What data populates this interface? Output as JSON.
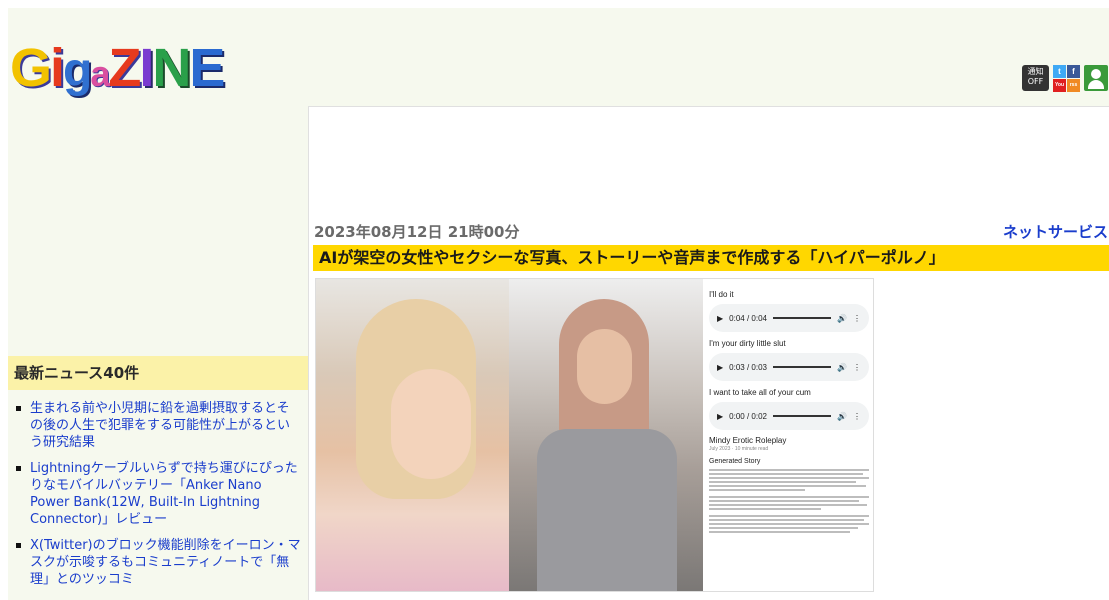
{
  "logo": {
    "g1": "G",
    "i": "i",
    "g2": "g",
    "a": "a",
    "z": "Z",
    "i2": "I",
    "n": "N",
    "e": "E"
  },
  "header_icons": {
    "notify_line1": "通知",
    "notify_line2": "OFF",
    "twitter": "t",
    "facebook": "f",
    "youtube": "You",
    "rss": "rss",
    "icons": [
      "notify-toggle-icon",
      "twitter-icon",
      "facebook-icon",
      "youtube-icon",
      "rss-icon",
      "user-icon"
    ]
  },
  "sidebar": {
    "heading": "最新ニュース40件",
    "items": [
      "生まれる前や小児期に鉛を過剰摂取するとその後の人生で犯罪をする可能性が上がるという研究結果",
      "Lightningケーブルいらずで持ち運びにぴったりなモバイルバッテリー「Anker Nano Power Bank(12W, Built-In Lightning Connector)」レビュー",
      "X(Twitter)のブロック機能削除をイーロン・マスクが示唆するもコミュニティノートで「無理」とのツッコミ"
    ]
  },
  "article": {
    "date": "2023年08月12日 21時00分",
    "category": "ネットサービス",
    "title": "AIが架空の女性やセクシーな写真、ストーリーや音声まで作成する「ハイパーポルノ」"
  },
  "image_panel": {
    "audio": [
      {
        "label": "I'll do it",
        "time": "0:04 / 0:04"
      },
      {
        "label": "I'm your dirty little slut",
        "time": "0:03 / 0:03"
      },
      {
        "label": "I want to take all of your cum",
        "time": "0:00 / 0:02"
      }
    ],
    "story_title": "Mindy Erotic Roleplay",
    "story_date": "July 2023 · 10 minute read",
    "story_heading": "Generated Story"
  },
  "colors": {
    "page_bg": "#f6f9ee",
    "title_bar": "#ffd700",
    "sidebar_heading_bg": "#fbf2a8",
    "link": "#1a3dcc"
  }
}
